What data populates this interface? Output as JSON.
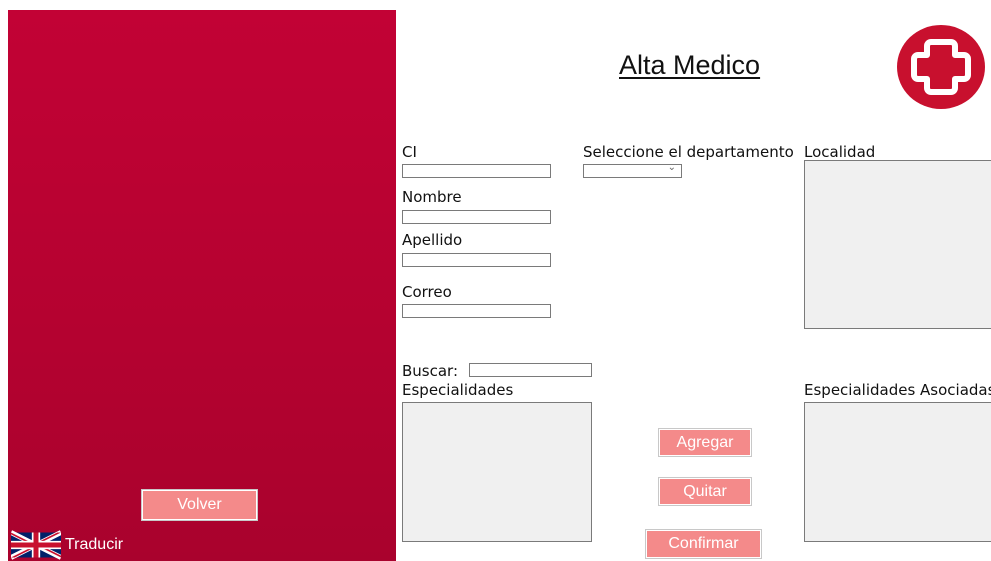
{
  "header": {
    "title": "Alta Medico"
  },
  "form": {
    "ci_label": "CI",
    "nombre_label": "Nombre",
    "apellido_label": "Apellido",
    "correo_label": "Correo",
    "departamento_label": "Seleccione el departamento",
    "localidad_label": "Localidad",
    "buscar_label": "Buscar:",
    "especialidades_label": "Especialidades",
    "asociadas_label": "Especialidades Asociadas",
    "ci_value": "",
    "nombre_value": "",
    "apellido_value": "",
    "correo_value": "",
    "buscar_value": "",
    "departamento_selected": ""
  },
  "buttons": {
    "agregar": "Agregar",
    "quitar": "Quitar",
    "confirmar": "Confirmar",
    "volver": "Volver",
    "traducir": "Traducir"
  },
  "icons": {
    "logo": "medical-cross-logo-icon",
    "flag": "uk-flag-icon",
    "dropdown": "chevron-down-icon"
  },
  "colors": {
    "sidebar": "#b80232",
    "button": "#f48a8a",
    "logo": "#c8102e"
  }
}
